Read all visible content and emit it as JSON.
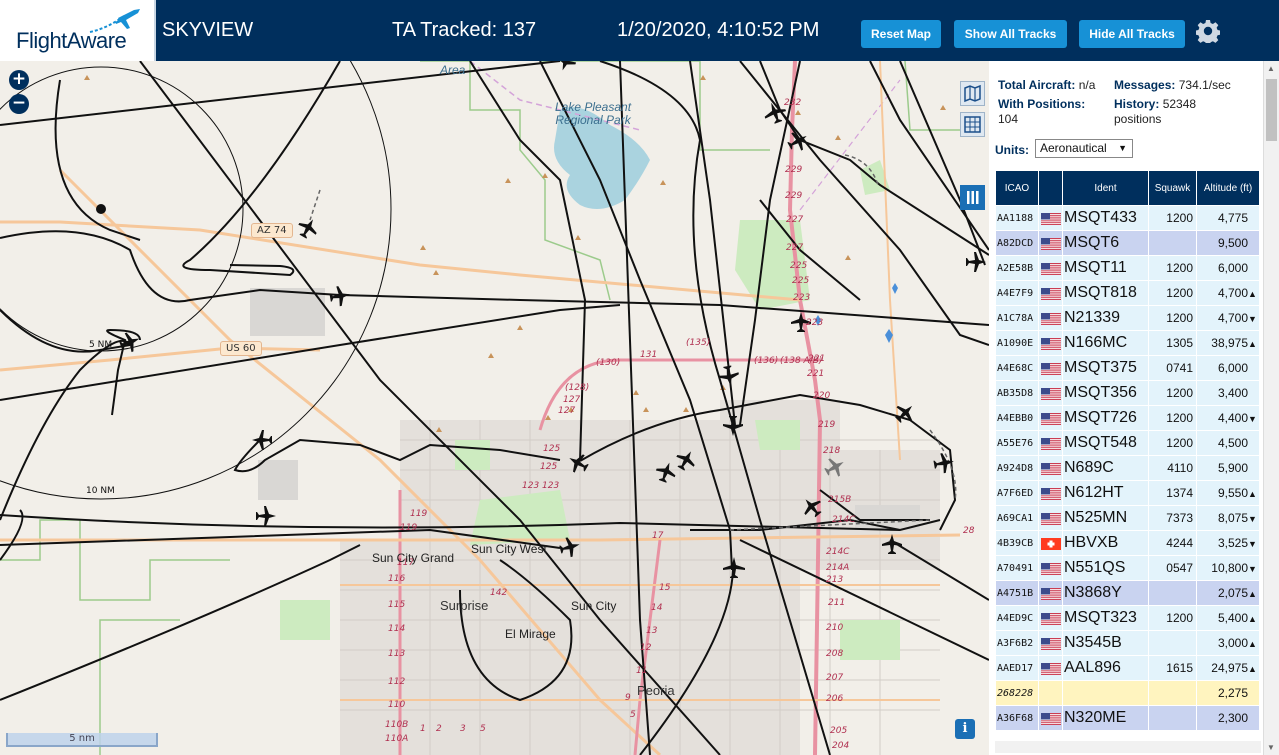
{
  "header": {
    "logo_text": "FlightAware",
    "app_title": "SKYVIEW",
    "tracked": "TA Tracked: 137",
    "clock": "1/20/2020, 4:10:52 PM",
    "reset_label": "Reset Map",
    "show_label": "Show All Tracks",
    "hide_label": "Hide All Tracks"
  },
  "map": {
    "places": {
      "lake": "Lake Pleasant Regional Park",
      "area": "Area",
      "surprise": "Surprise",
      "sun_city_grand": "Sun City Grand",
      "sun_city_west": "Sun City West",
      "sun_city": "Sun City",
      "el_mirage": "El Mirage",
      "peoria": "Peoria"
    },
    "roads": {
      "az74": "AZ 74",
      "us60": "US 60"
    },
    "range_rings": [
      "5 NM",
      "10 NM"
    ],
    "scale": "5 nm",
    "info": "i"
  },
  "sidebar": {
    "total_aircraft_label": "Total Aircraft:",
    "total_aircraft_value": "n/a",
    "messages_label": "Messages:",
    "messages_value": "734.1/sec",
    "positions_label": "With Positions:",
    "positions_value": "104",
    "history_label": "History:",
    "history_value": "52348",
    "history_unit": "positions",
    "units_label": "Units:",
    "units_value": "Aeronautical",
    "columns": [
      "ICAO",
      "",
      "Ident",
      "Squawk",
      "Altitude (ft)"
    ],
    "rows": [
      {
        "icao": "AA1188",
        "flag": "us",
        "ident": "MSQT433",
        "squawk": "1200",
        "alt": "4,775",
        "trend": "",
        "style": "row"
      },
      {
        "icao": "A82DCD",
        "flag": "us",
        "ident": "MSQT6",
        "squawk": "",
        "alt": "9,500",
        "trend": "",
        "style": "sel"
      },
      {
        "icao": "A2E58B",
        "flag": "us",
        "ident": "MSQT11",
        "squawk": "1200",
        "alt": "6,000",
        "trend": "",
        "style": "row"
      },
      {
        "icao": "A4E7F9",
        "flag": "us",
        "ident": "MSQT818",
        "squawk": "1200",
        "alt": "4,700",
        "trend": "▲",
        "style": "row"
      },
      {
        "icao": "A1C78A",
        "flag": "us",
        "ident": "N21339",
        "squawk": "1200",
        "alt": "4,700",
        "trend": "▼",
        "style": "row"
      },
      {
        "icao": "A1090E",
        "flag": "us",
        "ident": "N166MC",
        "squawk": "1305",
        "alt": "38,975",
        "trend": "▲",
        "style": "row"
      },
      {
        "icao": "A4E68C",
        "flag": "us",
        "ident": "MSQT375",
        "squawk": "0741",
        "alt": "6,000",
        "trend": "",
        "style": "row"
      },
      {
        "icao": "AB35D8",
        "flag": "us",
        "ident": "MSQT356",
        "squawk": "1200",
        "alt": "3,400",
        "trend": "",
        "style": "row"
      },
      {
        "icao": "A4EBB0",
        "flag": "us",
        "ident": "MSQT726",
        "squawk": "1200",
        "alt": "4,400",
        "trend": "▼",
        "style": "row"
      },
      {
        "icao": "A55E76",
        "flag": "us",
        "ident": "MSQT548",
        "squawk": "1200",
        "alt": "4,500",
        "trend": "",
        "style": "row"
      },
      {
        "icao": "A924D8",
        "flag": "us",
        "ident": "N689C",
        "squawk": "4110",
        "alt": "5,900",
        "trend": "",
        "style": "row"
      },
      {
        "icao": "A7F6ED",
        "flag": "us",
        "ident": "N612HT",
        "squawk": "1374",
        "alt": "9,550",
        "trend": "▲",
        "style": "row"
      },
      {
        "icao": "A69CA1",
        "flag": "us",
        "ident": "N525MN",
        "squawk": "7373",
        "alt": "8,075",
        "trend": "▼",
        "style": "row"
      },
      {
        "icao": "4B39CB",
        "flag": "ch",
        "ident": "HBVXB",
        "squawk": "4244",
        "alt": "3,525",
        "trend": "▼",
        "style": "row"
      },
      {
        "icao": "A70491",
        "flag": "us",
        "ident": "N551QS",
        "squawk": "0547",
        "alt": "10,800",
        "trend": "▼",
        "style": "row"
      },
      {
        "icao": "A4751B",
        "flag": "us",
        "ident": "N3868Y",
        "squawk": "",
        "alt": "2,075",
        "trend": "▲",
        "style": "sel"
      },
      {
        "icao": "A4ED9C",
        "flag": "us",
        "ident": "MSQT323",
        "squawk": "1200",
        "alt": "5,400",
        "trend": "▲",
        "style": "row"
      },
      {
        "icao": "A3F6B2",
        "flag": "us",
        "ident": "N3545B",
        "squawk": "",
        "alt": "3,000",
        "trend": "▲",
        "style": "row"
      },
      {
        "icao": "AAED17",
        "flag": "us",
        "ident": "AAL896",
        "squawk": "1615",
        "alt": "24,975",
        "trend": "▲",
        "style": "row"
      },
      {
        "icao": "268228",
        "flag": "",
        "ident": "",
        "squawk": "",
        "alt": "2,275",
        "trend": "",
        "style": "anon"
      },
      {
        "icao": "A36F68",
        "flag": "us",
        "ident": "N320ME",
        "squawk": "",
        "alt": "2,300",
        "trend": "",
        "style": "sel"
      }
    ]
  },
  "colors": {
    "header_bg": "#002f5d",
    "button_bg": "#1791d6",
    "row_bg": "#e3f3fb",
    "selected_row_bg": "#c9d3f0",
    "anon_row_bg": "#fff4bf"
  }
}
